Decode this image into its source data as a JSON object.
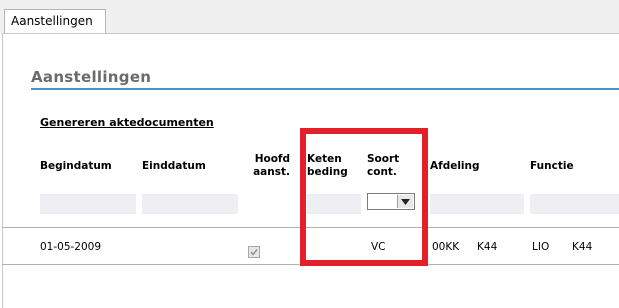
{
  "tab": {
    "label": "Aanstellingen"
  },
  "section": {
    "title": "Aanstellingen"
  },
  "actions": {
    "generate_link": "Genereren aktedocumenten"
  },
  "table": {
    "headers": {
      "begindatum": "Begindatum",
      "einddatum": "Einddatum",
      "hoofd_line1": "Hoofd",
      "hoofd_line2": "aanst.",
      "keten_line1": "Keten",
      "keten_line2": "beding",
      "soort_line1": "Soort",
      "soort_line2": "cont.",
      "afdeling": "Afdeling",
      "functie": "Functie"
    },
    "row": {
      "begindatum": "01-05-2009",
      "einddatum": "",
      "hoofd_checked": true,
      "keten": "",
      "soort": "VC",
      "afdeling_code": "00KK",
      "afdeling_num": "K44",
      "functie_code": "LIO",
      "functie_num": "K44"
    }
  },
  "colors": {
    "accent_line": "#4a8fc9",
    "highlight": "#e32027"
  }
}
